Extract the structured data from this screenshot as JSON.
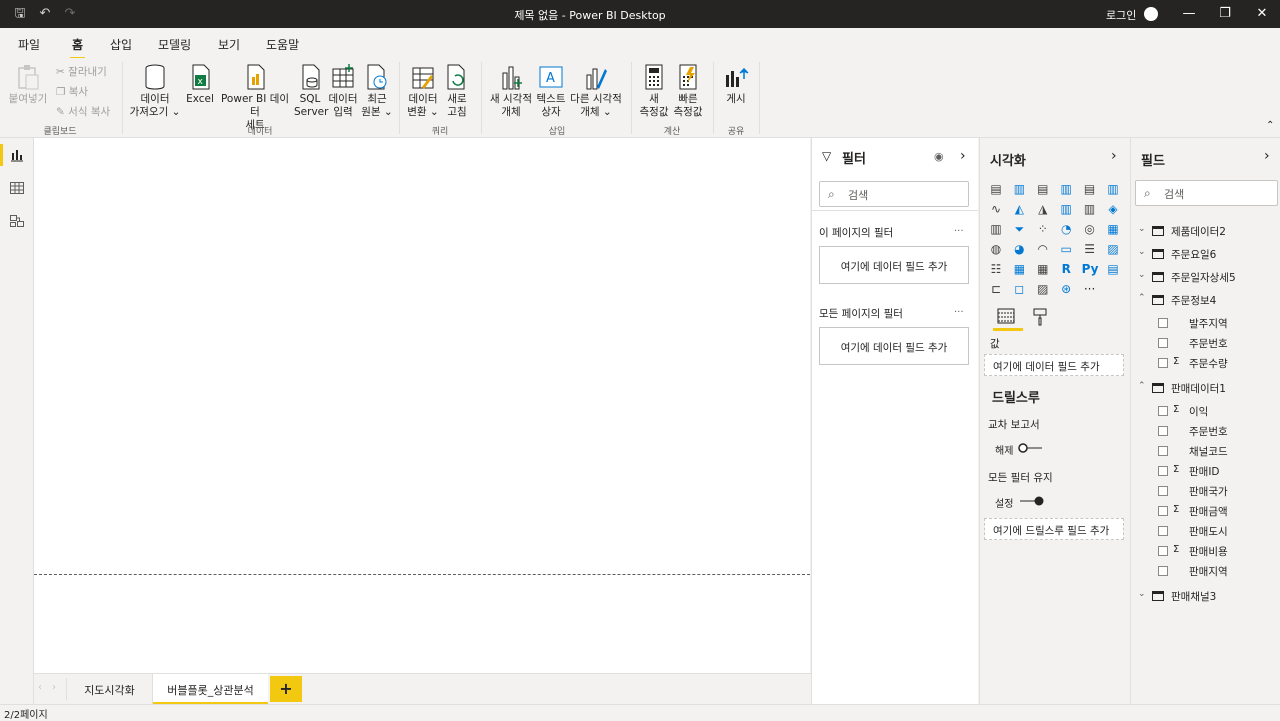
{
  "window": {
    "title": "제목 없음 - Power BI Desktop",
    "login": "로그인"
  },
  "menu": {
    "tabs": [
      "파일",
      "홈",
      "삽입",
      "모델링",
      "보기",
      "도움말"
    ],
    "active": "홈"
  },
  "ribbon": {
    "clipboard": {
      "paste": "붙여넣기",
      "cut": "잘라내기",
      "copy": "복사",
      "format_painter": "서식 복사",
      "group": "클립보드"
    },
    "data": {
      "get_data": [
        "데이터",
        "가져오기"
      ],
      "excel": "Excel",
      "pbi_dataset": [
        "Power BI 데이터",
        "세트"
      ],
      "sql": [
        "SQL",
        "Server"
      ],
      "enter_data": [
        "데이터",
        "입력"
      ],
      "recent": [
        "최근",
        "원본"
      ],
      "group": "데이터"
    },
    "query": {
      "transform": [
        "데이터",
        "변환"
      ],
      "refresh": [
        "새로",
        "고침"
      ],
      "group": "쿼리"
    },
    "insert": {
      "new_visual": [
        "새 시각적",
        "개체"
      ],
      "textbox": [
        "텍스트",
        "상자"
      ],
      "more_visuals": [
        "다른 시각적",
        "개체"
      ],
      "group": "삽입"
    },
    "calc": {
      "new_measure": [
        "새",
        "측정값"
      ],
      "quick_measure": [
        "빠른",
        "측정값"
      ],
      "group": "계산"
    },
    "share": {
      "publish": "게시",
      "group": "공유"
    }
  },
  "pages": {
    "tabs": [
      "지도시각화",
      "버블플롯_상관분석"
    ],
    "active": "버블플롯_상관분석",
    "add": "+"
  },
  "status": {
    "page": "2/2페이지"
  },
  "filters": {
    "title": "필터",
    "search": "검색",
    "this_page": "이 페이지의 필터",
    "all_pages": "모든 페이지의 필터",
    "add_field": "여기에 데이터 필드 추가",
    "more": "..."
  },
  "viz": {
    "title": "시각화",
    "values_label": "값",
    "add_field": "여기에 데이터 필드 추가",
    "drillthrough": "드릴스루",
    "cross_report": "교차 보고서",
    "cross_report_state": "해제",
    "keep_filters": "모든 필터 유지",
    "keep_filters_state": "설정",
    "add_drill": "여기에 드릴스루 필드 추가",
    "icon_colors": [
      "#404040",
      "#107c41",
      "#0078d4",
      "#e8a200",
      "#a4373a"
    ]
  },
  "fields": {
    "title": "필드",
    "search": "검색",
    "tables": [
      {
        "name": "제품데이터2",
        "expanded": false,
        "fields": []
      },
      {
        "name": "주문요일6",
        "expanded": false,
        "fields": []
      },
      {
        "name": "주문일자상세5",
        "expanded": false,
        "fields": []
      },
      {
        "name": "주문정보4",
        "expanded": true,
        "fields": [
          {
            "name": "발주지역",
            "sigma": false
          },
          {
            "name": "주문번호",
            "sigma": false
          },
          {
            "name": "주문수량",
            "sigma": true
          }
        ]
      },
      {
        "name": "판매데이터1",
        "expanded": true,
        "fields": [
          {
            "name": "이익",
            "sigma": true
          },
          {
            "name": "주문번호",
            "sigma": false
          },
          {
            "name": "채널코드",
            "sigma": false
          },
          {
            "name": "판매ID",
            "sigma": true
          },
          {
            "name": "판매국가",
            "sigma": false
          },
          {
            "name": "판매금액",
            "sigma": true
          },
          {
            "name": "판매도시",
            "sigma": false
          },
          {
            "name": "판매비용",
            "sigma": true
          },
          {
            "name": "판매지역",
            "sigma": false
          }
        ]
      },
      {
        "name": "판매채널3",
        "expanded": false,
        "fields": []
      }
    ]
  }
}
